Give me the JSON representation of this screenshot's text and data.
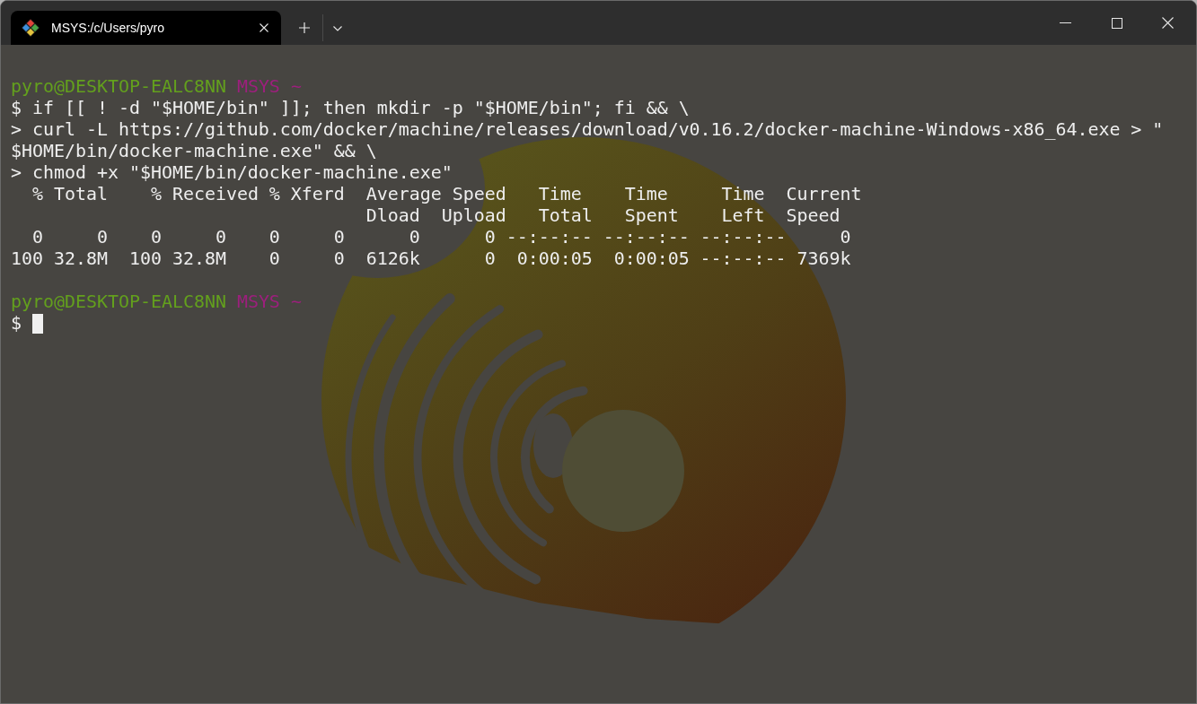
{
  "window": {
    "tabs": [
      {
        "title": "MSYS:/c/Users/pyro",
        "selected": true
      }
    ]
  },
  "terminal": {
    "lines": [
      {
        "kind": "prompt",
        "user_host": "pyro@DESKTOP-EALC8NN",
        "env": "MSYS",
        "path": "~"
      },
      {
        "kind": "text",
        "text": "$ if [[ ! -d \"$HOME/bin\" ]]; then mkdir -p \"$HOME/bin\"; fi && \\"
      },
      {
        "kind": "text",
        "text": "> curl -L https://github.com/docker/machine/releases/download/v0.16.2/docker-machine-Windows-x86_64.exe > \""
      },
      {
        "kind": "text",
        "text": "$HOME/bin/docker-machine.exe\" && \\"
      },
      {
        "kind": "text",
        "text": "> chmod +x \"$HOME/bin/docker-machine.exe\""
      },
      {
        "kind": "text",
        "text": "  % Total    % Received % Xferd  Average Speed   Time    Time     Time  Current"
      },
      {
        "kind": "text",
        "text": "                                 Dload  Upload   Total   Spent    Left  Speed"
      },
      {
        "kind": "text",
        "text": "  0     0    0     0    0     0      0      0 --:--:-- --:--:-- --:--:--     0"
      },
      {
        "kind": "text",
        "text": "100 32.8M  100 32.8M    0     0  6126k      0  0:00:05  0:00:05 --:--:-- 7369k"
      },
      {
        "kind": "blank"
      },
      {
        "kind": "prompt",
        "user_host": "pyro@DESKTOP-EALC8NN",
        "env": "MSYS",
        "path": "~"
      },
      {
        "kind": "input",
        "symbol": "$",
        "cursor": true
      }
    ]
  }
}
